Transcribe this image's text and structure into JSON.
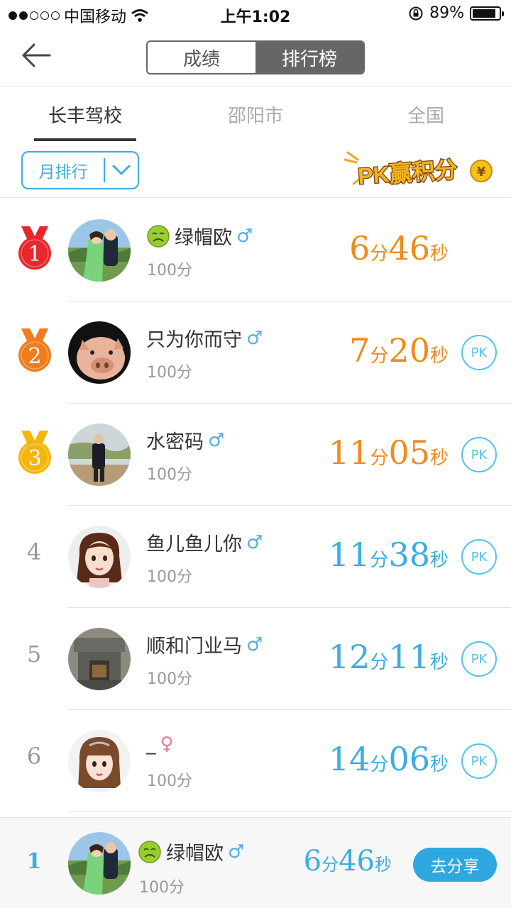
{
  "status_bar": {
    "carrier": "中国移动",
    "time": "上午1:02",
    "battery": "89%",
    "battery_level": 0.89
  },
  "header": {
    "segments": [
      "成绩",
      "排行榜"
    ],
    "active_segment": "排行榜"
  },
  "region_tabs": [
    "长丰驾校",
    "邵阳市",
    "全国"
  ],
  "active_region": "长丰驾校",
  "filter": {
    "period_label": "月排行",
    "pk_banner_text": "PK赢积分",
    "pk_banner_coin": "¥"
  },
  "ranking": [
    {
      "rank": "1",
      "name": "绿帽欧",
      "has_emoji": true,
      "gender": "♂",
      "score": "100分",
      "min": "6",
      "sec": "46",
      "color": "#f08a1c",
      "pk": false,
      "medal_color": "#e8262b",
      "avatar": "couple"
    },
    {
      "rank": "2",
      "name": "只为你而守",
      "has_emoji": false,
      "gender": "♂",
      "score": "100分",
      "min": "7",
      "sec": "20",
      "color": "#f08a1c",
      "pk": true,
      "medal_color": "#f07c1c",
      "avatar": "pig"
    },
    {
      "rank": "3",
      "name": "水密码",
      "has_emoji": false,
      "gender": "♂",
      "score": "100分",
      "min": "11",
      "sec": "05",
      "color": "#f08a1c",
      "pk": true,
      "medal_color": "#f5b50a",
      "avatar": "person"
    },
    {
      "rank": "4",
      "name": "鱼儿鱼儿你",
      "has_emoji": false,
      "gender": "♂",
      "score": "100分",
      "min": "11",
      "sec": "38",
      "color": "#3aaee0",
      "pk": true,
      "avatar": "girl"
    },
    {
      "rank": "5",
      "name": "顺和门业马",
      "has_emoji": false,
      "gender": "♂",
      "score": "100分",
      "min": "12",
      "sec": "11",
      "color": "#3aaee0",
      "pk": true,
      "avatar": "building"
    },
    {
      "rank": "6",
      "name": "_",
      "has_emoji": false,
      "gender": "♀",
      "score": "100分",
      "min": "14",
      "sec": "06",
      "color": "#3aaee0",
      "pk": true,
      "avatar": "girl2"
    }
  ],
  "labels": {
    "minute_unit": "分",
    "second_unit": "秒",
    "pk_button": "PK",
    "share_button": "去分享"
  },
  "my_rank": {
    "rank": "1",
    "name": "绿帽欧",
    "gender": "♂",
    "score": "100分",
    "min": "6",
    "sec": "46"
  }
}
